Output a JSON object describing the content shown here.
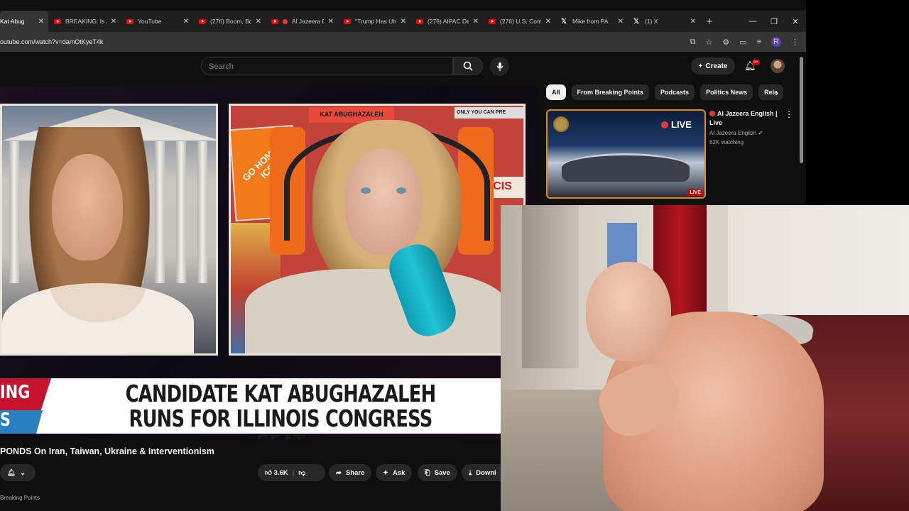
{
  "browser": {
    "tabs": [
      {
        "title": "Kat Abug",
        "icon": "youtube-icon",
        "active": true
      },
      {
        "title": "BREAKING: Is A",
        "icon": "youtube-icon",
        "active": false
      },
      {
        "title": "YouTube",
        "icon": "youtube-icon",
        "active": false
      },
      {
        "title": "(276) Boom, Bo",
        "icon": "youtube-icon",
        "active": false
      },
      {
        "title": "Al Jazeera E",
        "icon": "youtube-icon",
        "active": false
      },
      {
        "title": "\"Trump Has Uh",
        "icon": "youtube-icon",
        "active": false
      },
      {
        "title": "(276) AIPAC De",
        "icon": "youtube-icon",
        "active": false
      },
      {
        "title": "(276) U.S. Com",
        "icon": "youtube-icon",
        "active": false
      },
      {
        "title": "Mike from PA",
        "icon": "x-icon",
        "active": false
      },
      {
        "title": "(1) X",
        "icon": "x-icon",
        "active": false
      }
    ],
    "new_tab": "+",
    "window_controls": [
      "—",
      "❐",
      "✕"
    ],
    "url": "outube.com/watch?v=damOtKyeT4k",
    "profile_initial": "R"
  },
  "youtube": {
    "search_placeholder": "Search",
    "create_label": "Create",
    "notification_count": "9+",
    "video": {
      "lower_third_tag_top": "ING",
      "lower_third_tag_bottom": "S",
      "lower_third_headline": "CANDIDATE KAT ABUGHAZALEH RUNS FOR ILLINOIS CONGRESS SEAT",
      "poster_text_1": "GO HOME ICE",
      "poster_text_2": "KAT ABUGHAZALEH",
      "poster_text_3": "ONLY YOU CAN PRE",
      "poster_text_4": "ASCIS"
    },
    "title": "PONDS On Iran, Taiwan, Ukraine & Interventionism",
    "actions": {
      "like_count": "3.6K",
      "share": "Share",
      "ask": "Ask",
      "save": "Save",
      "download": "Downl"
    },
    "channel_partial": "Breaking Points",
    "chips": [
      "All",
      "From Breaking Points",
      "Podcasts",
      "Politics News",
      "Rela"
    ],
    "recommendation": {
      "title": "Al Jazeera English | Live",
      "channel": "Al Jazeera English",
      "watching": "62K watching",
      "live_overlay": "LIVE",
      "live_badge": "LIVE"
    }
  },
  "colors": {
    "youtube_red": "#ff0000",
    "lower_third_red": "#c4122f",
    "lower_third_blue": "#2a7fc1",
    "live_red": "#cc0000"
  }
}
